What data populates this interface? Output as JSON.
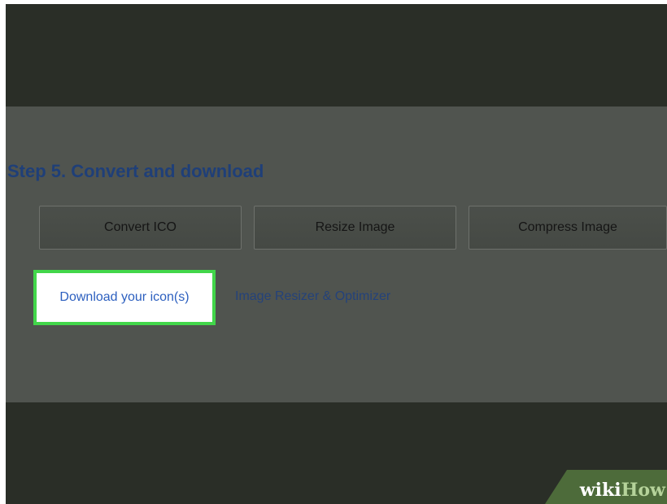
{
  "step": {
    "title": "Step 5. Convert and download"
  },
  "buttons": {
    "convert_label": "Convert ICO",
    "resize_label": "Resize Image",
    "compress_label": "Compress Image"
  },
  "links": {
    "download_label": "Download your icon(s)",
    "optimizer_label": "Image Resizer & Optimizer"
  },
  "watermark": {
    "part1": "wiki",
    "part2": "How"
  },
  "colors": {
    "highlight_border": "#42d64a",
    "link_blue": "#2c5fbf",
    "title_blue": "#1f3f78",
    "dark_background": "#2a2e27",
    "panel_gray": "#50544f",
    "brand_green": "#4d6b3a"
  }
}
